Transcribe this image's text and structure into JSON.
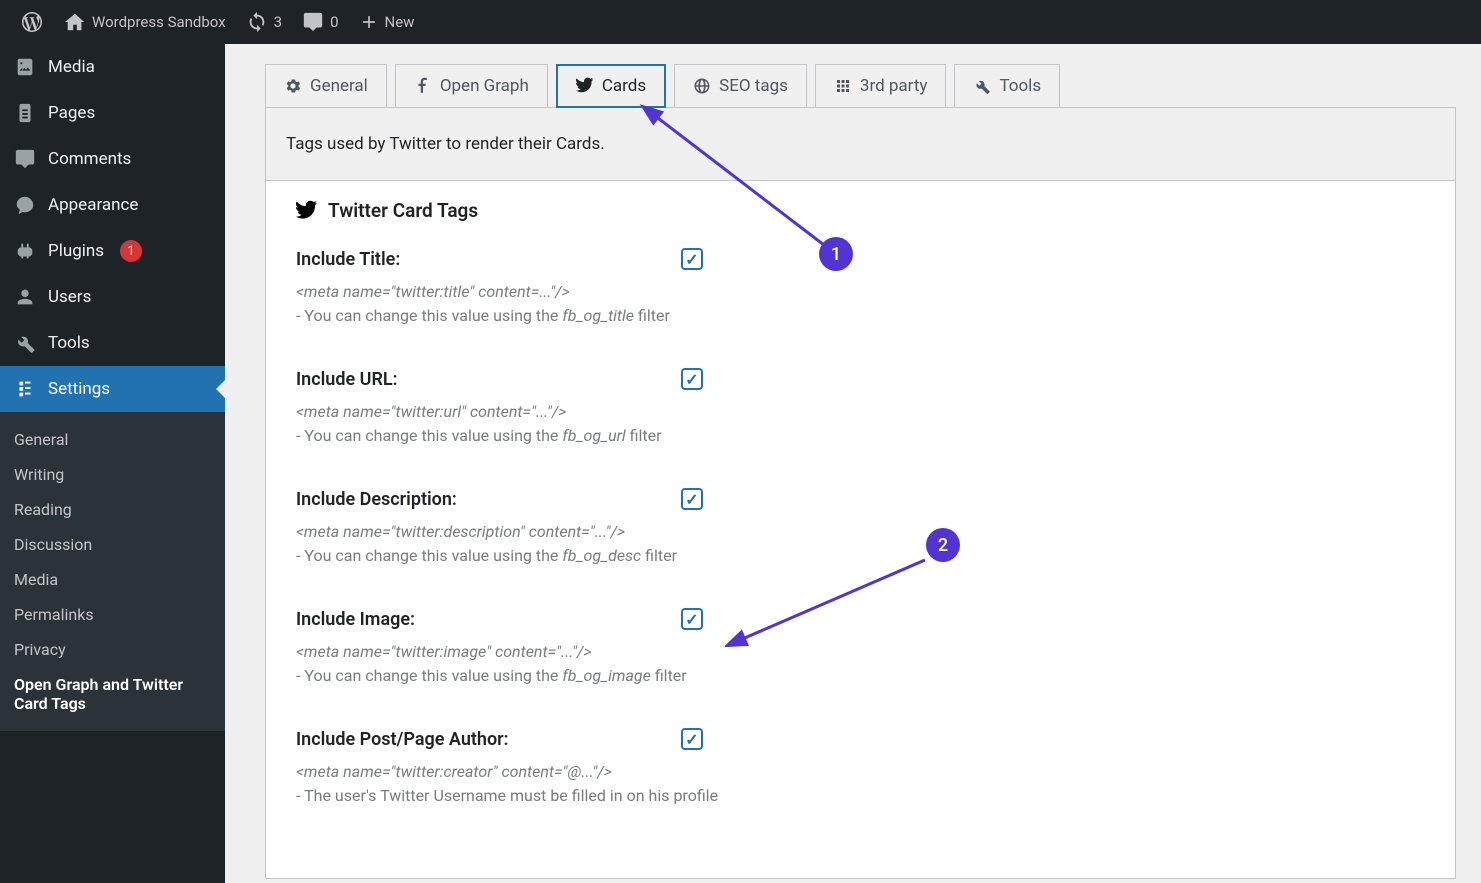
{
  "adminbar": {
    "site_name": "Wordpress Sandbox",
    "updates": "3",
    "comments": "0",
    "new": "New"
  },
  "sidebar": {
    "media": "Media",
    "pages": "Pages",
    "comments": "Comments",
    "appearance": "Appearance",
    "plugins": "Plugins",
    "plugins_badge": "1",
    "users": "Users",
    "tools": "Tools",
    "settings": "Settings",
    "submenu": {
      "general": "General",
      "writing": "Writing",
      "reading": "Reading",
      "discussion": "Discussion",
      "media": "Media",
      "permalinks": "Permalinks",
      "privacy": "Privacy",
      "og": "Open Graph and Twitter Card Tags"
    }
  },
  "tabs": {
    "general": "General",
    "opengraph": "Open Graph",
    "cards": "Cards",
    "seo": "SEO tags",
    "thirdparty": "3rd party",
    "tools": "Tools"
  },
  "panel": {
    "description": "Tags used by Twitter to render their Cards.",
    "heading": "Twitter Card Tags"
  },
  "fields": {
    "title": {
      "label": "Include Title:",
      "meta": "<meta name=\"twitter:title\" content=...\"/>",
      "help_pre": "- You can change this value using the ",
      "help_filter": "fb_og_title",
      "help_post": " filter"
    },
    "url": {
      "label": "Include URL:",
      "meta": "<meta name=\"twitter:url\" content=\"...\"/>",
      "help_pre": "- You can change this value using the ",
      "help_filter": "fb_og_url",
      "help_post": " filter"
    },
    "desc": {
      "label": "Include Description:",
      "meta": "<meta name=\"twitter:description\" content=\"...\"/>",
      "help_pre": "- You can change this value using the ",
      "help_filter": "fb_og_desc",
      "help_post": " filter"
    },
    "image": {
      "label": "Include Image:",
      "meta": "<meta name=\"twitter:image\" content=\"...\"/>",
      "help_pre": "- You can change this value using the ",
      "help_filter": "fb_og_image",
      "help_post": " filter"
    },
    "author": {
      "label": "Include Post/Page Author:",
      "meta": "<meta name=\"twitter:creator\" content=\"@...\"/>",
      "help": "- The user's Twitter Username must be filled in on his profile"
    }
  },
  "annotations": {
    "one": "1",
    "two": "2"
  }
}
